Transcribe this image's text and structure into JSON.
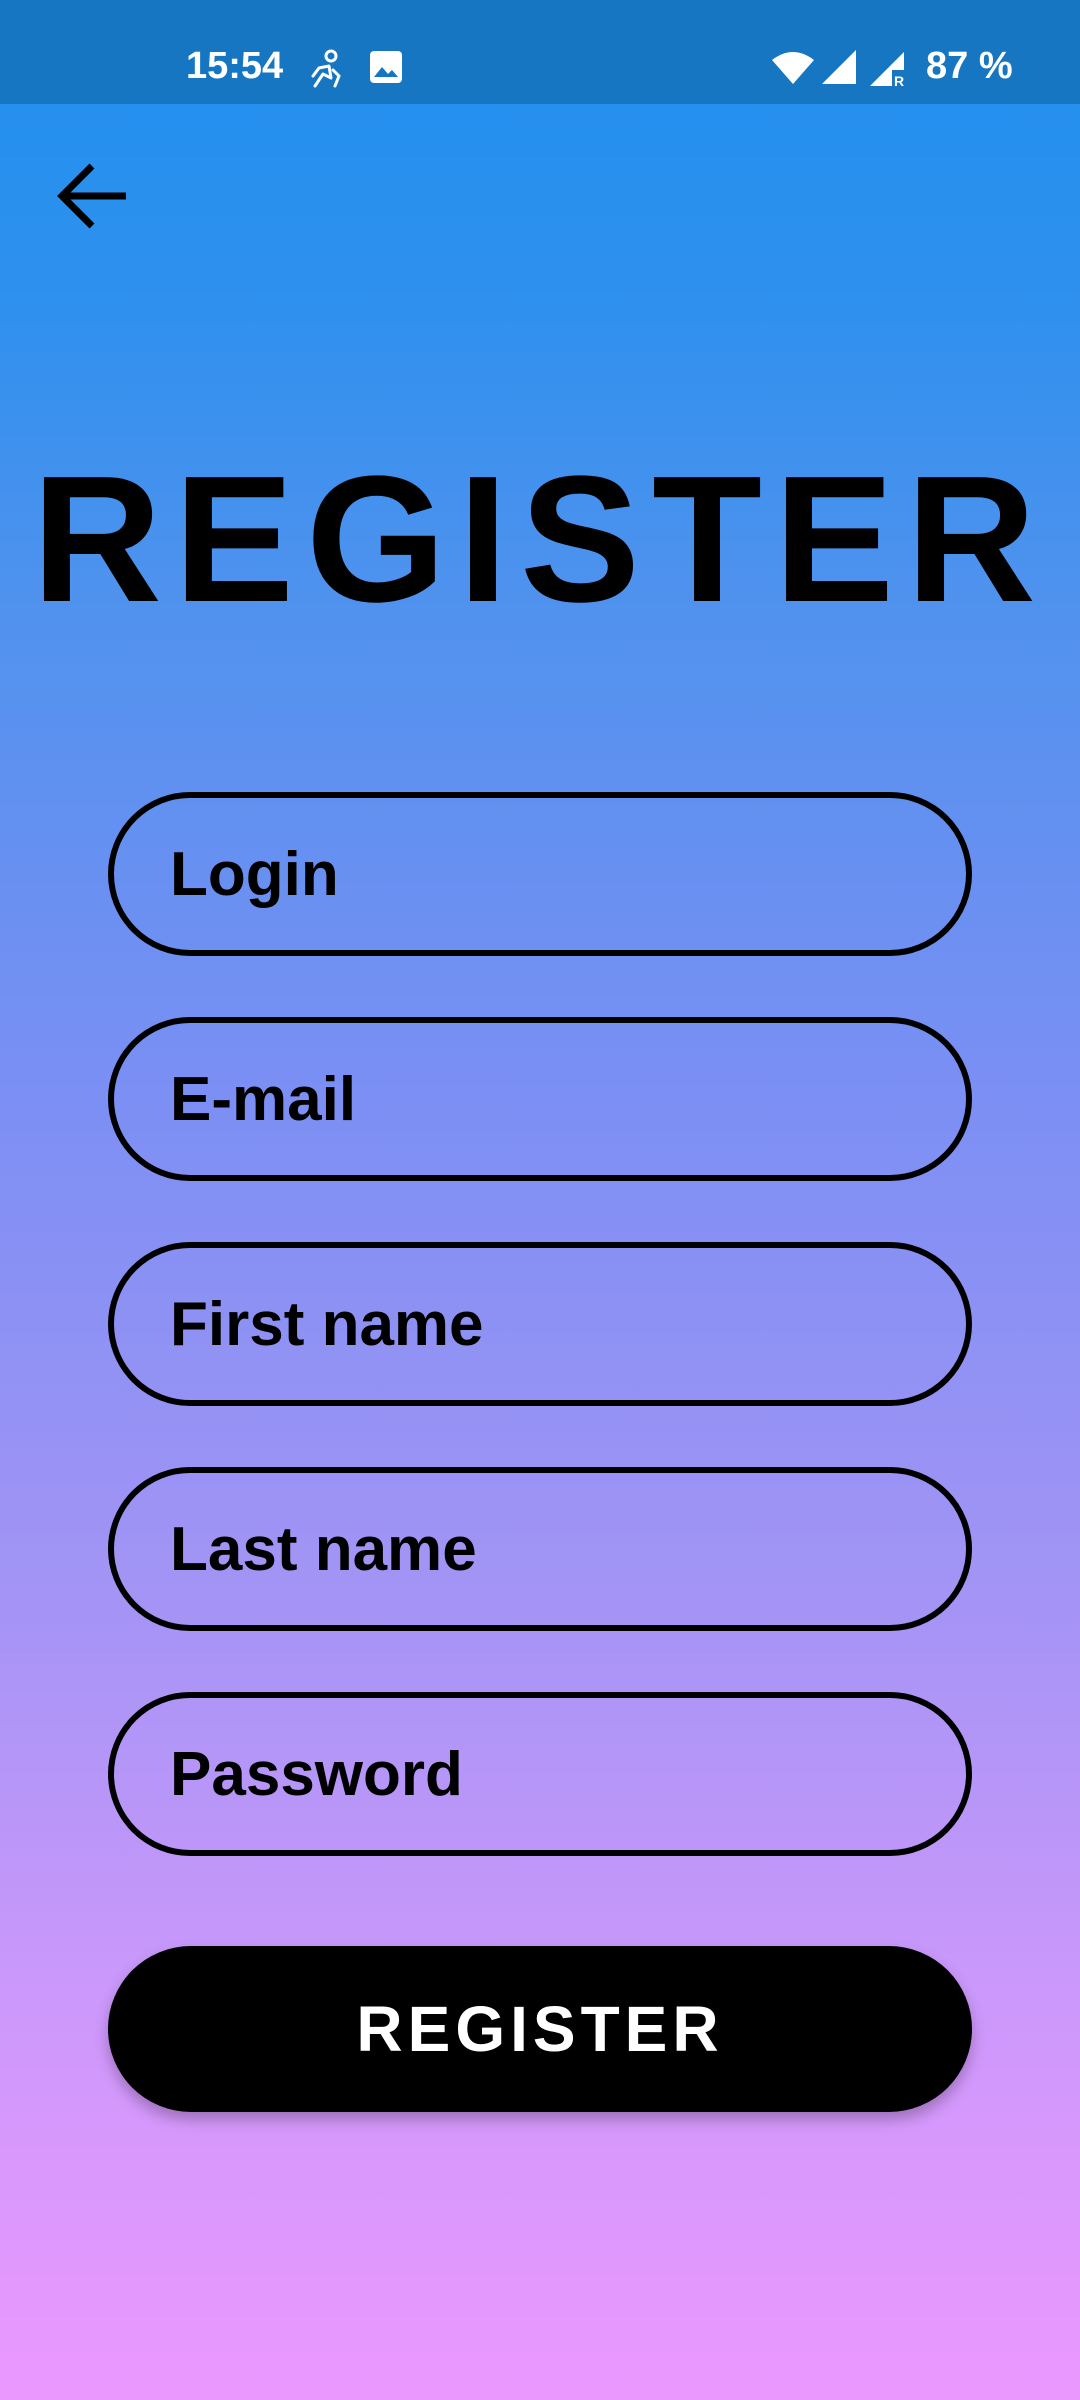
{
  "status_bar": {
    "time": "15:54",
    "battery": "87 %",
    "icons": [
      "activity-icon",
      "image-icon",
      "wifi-icon",
      "signal-icon",
      "signal-roaming-icon"
    ]
  },
  "header": {
    "back_icon": "arrow-left-icon"
  },
  "title": "REGISTER",
  "form": {
    "login_placeholder": "Login",
    "email_placeholder": "E-mail",
    "first_name_placeholder": "First name",
    "last_name_placeholder": "Last name",
    "password_placeholder": "Password",
    "submit_label": "REGISTER"
  },
  "colors": {
    "status_bar": "#1776c2",
    "gradient_top": "#1f8fef",
    "gradient_bottom": "#eb98fe",
    "button": "#000000"
  }
}
